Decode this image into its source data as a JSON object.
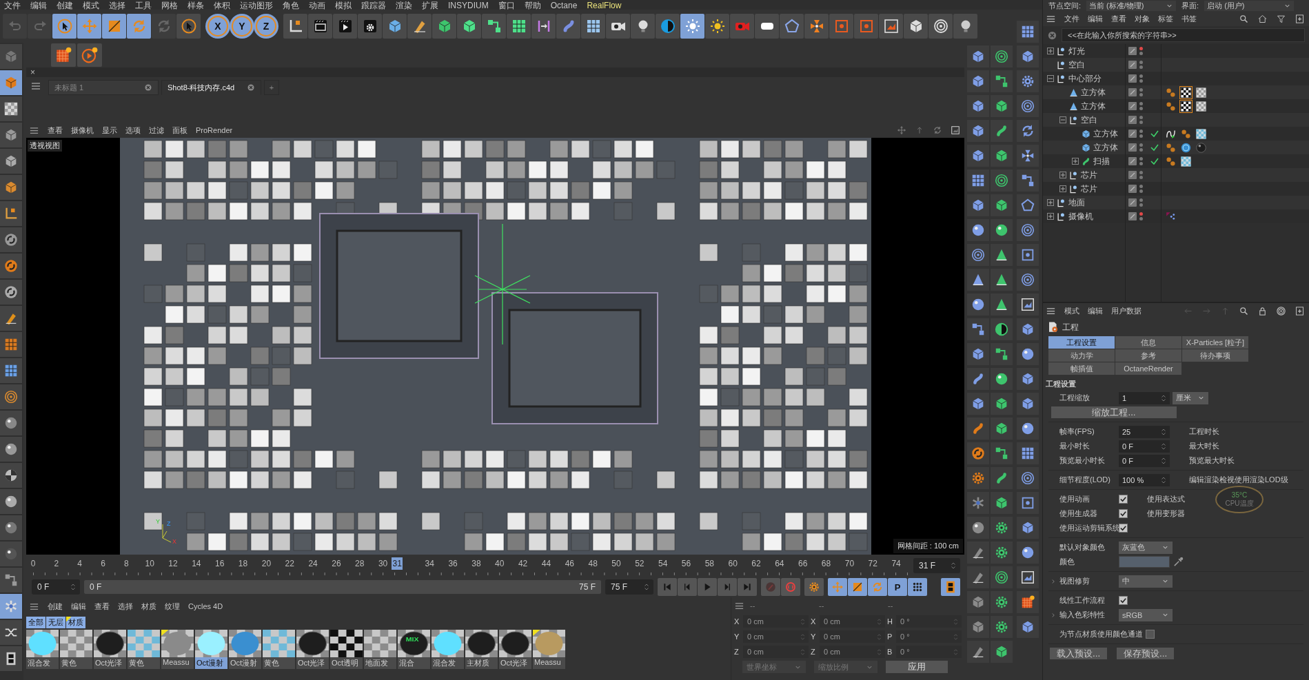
{
  "menu_bar": [
    {
      "label": "文件",
      "highlighted": false
    },
    {
      "label": "编辑",
      "highlighted": false
    },
    {
      "label": "创建",
      "highlighted": false
    },
    {
      "label": "模式",
      "highlighted": false
    },
    {
      "label": "选择",
      "highlighted": false
    },
    {
      "label": "工具",
      "highlighted": false
    },
    {
      "label": "网格",
      "highlighted": false
    },
    {
      "label": "样条",
      "highlighted": false
    },
    {
      "label": "体积",
      "highlighted": false
    },
    {
      "label": "运动图形",
      "highlighted": false
    },
    {
      "label": "角色",
      "highlighted": false
    },
    {
      "label": "动画",
      "highlighted": false
    },
    {
      "label": "模拟",
      "highlighted": false
    },
    {
      "label": "跟踪器",
      "highlighted": false
    },
    {
      "label": "渲染",
      "highlighted": false
    },
    {
      "label": "扩展",
      "highlighted": false
    },
    {
      "label": "INSYDIUM",
      "highlighted": false
    },
    {
      "label": "窗口",
      "highlighted": false
    },
    {
      "label": "帮助",
      "highlighted": false
    },
    {
      "label": "Octane",
      "highlighted": false
    },
    {
      "label": "RealFlow",
      "highlighted": true
    }
  ],
  "node_space": {
    "label": "节点空间:",
    "value": "当前 (标准/物理)"
  },
  "interface": {
    "label": "界面:",
    "value": "启动 (用户)"
  },
  "toolbar_left": [
    {
      "selected": false,
      "disabled": true
    },
    {
      "selected": false,
      "disabled": true
    },
    {
      "selected": true,
      "disabled": false
    },
    {
      "selected": true,
      "disabled": false
    },
    {
      "selected": true,
      "disabled": false
    },
    {
      "selected": true,
      "disabled": false
    },
    {
      "selected": false,
      "disabled": true
    },
    {
      "selected": false,
      "disabled": false
    }
  ],
  "axis_buttons": [
    {
      "label": "X",
      "selected": true
    },
    {
      "label": "Y",
      "selected": true
    },
    {
      "label": "Z",
      "selected": true
    }
  ],
  "toolbar_right": [
    {
      "selected": false
    },
    {
      "selected": false
    },
    {
      "selected": false
    },
    {
      "selected": false
    },
    {
      "selected": false
    },
    {
      "selected": false
    },
    {
      "selected": false
    },
    {
      "selected": false
    },
    {
      "selected": false
    },
    {
      "selected": false
    },
    {
      "selected": false
    },
    {
      "selected": false
    },
    {
      "selected": false
    },
    {
      "selected": false
    },
    {
      "selected": false
    },
    {
      "selected": false
    },
    {
      "selected": true
    },
    {
      "selected": false
    },
    {
      "selected": false
    },
    {
      "selected": false
    },
    {
      "selected": false
    },
    {
      "selected": false
    },
    {
      "selected": false
    },
    {
      "selected": false
    },
    {
      "selected": false
    },
    {
      "selected": false
    },
    {
      "selected": false
    },
    {
      "selected": false
    }
  ],
  "left_palette": [
    {
      "selected": false
    },
    {
      "selected": true
    },
    {
      "selected": false
    },
    {
      "selected": false
    },
    {
      "selected": false
    },
    {
      "selected": false
    },
    {
      "selected": false
    },
    {
      "selected": false
    },
    {
      "selected": false
    },
    {
      "selected": false
    },
    {
      "selected": false
    },
    {
      "selected": false
    },
    {
      "selected": false
    },
    {
      "selected": false
    },
    {
      "selected": false
    },
    {
      "selected": false
    },
    {
      "selected": false
    },
    {
      "selected": false
    },
    {
      "selected": false
    },
    {
      "selected": false
    },
    {
      "selected": false
    },
    {
      "selected": true
    },
    {
      "selected": false
    },
    {
      "selected": false
    }
  ],
  "close_glyph": "×",
  "document_tabs": [
    {
      "label": "未标题 1",
      "selected": false
    },
    {
      "label": "Shot8-科技内存.c4d",
      "selected": true
    }
  ],
  "add_tab": "+",
  "viewport": {
    "menu": [
      "查看",
      "摄像机",
      "显示",
      "选项",
      "过滤",
      "面板",
      "ProRender"
    ],
    "camera_label": "透视视图",
    "grid_label": "网格间距 : 100 cm",
    "axes": [
      "Y",
      "Z",
      "X"
    ]
  },
  "timeline": {
    "ticks": [
      "0",
      "2",
      "4",
      "6",
      "8",
      "10",
      "12",
      "14",
      "16",
      "18",
      "20",
      "22",
      "24",
      "26",
      "28",
      "30",
      "34",
      "36",
      "38",
      "40",
      "42",
      "44",
      "46",
      "48",
      "50",
      "52",
      "54",
      "56",
      "58",
      "60",
      "62",
      "64",
      "66",
      "68",
      "70",
      "72",
      "74"
    ],
    "current": "31",
    "level": 0.4133,
    "frame_field": "31 F"
  },
  "range": {
    "start": "0 F",
    "slider_start": "0 F",
    "slider_end": "75 F",
    "end": "75 F",
    "level": 1
  },
  "transport_tools": [
    {
      "selected": true
    },
    {
      "selected": true
    },
    {
      "selected": true
    },
    {
      "selected": true
    },
    {
      "selected": true
    }
  ],
  "param_label": "P",
  "film_selected": true,
  "material_menu": [
    "创建",
    "编辑",
    "查看",
    "选择",
    "材质",
    "纹理",
    "Cycles 4D"
  ],
  "material_filters": [
    {
      "label": "全部",
      "selected": true,
      "flagged": false
    },
    {
      "label": "无层",
      "selected": true,
      "flagged": false
    },
    {
      "label": "材质",
      "selected": true,
      "flagged": true
    }
  ],
  "materials": [
    {
      "name": "混合发",
      "kind": "glow",
      "selected": false,
      "flagged": false
    },
    {
      "name": "黄色",
      "kind": "checker",
      "selected": false,
      "flagged": false
    },
    {
      "name": "Oct光泽",
      "kind": "dark",
      "selected": false,
      "flagged": false
    },
    {
      "name": "黄色",
      "kind": "bluecheck",
      "selected": false,
      "flagged": false
    },
    {
      "name": "Meassu",
      "kind": "grey",
      "selected": false,
      "flagged": true
    },
    {
      "name": "Oct漫射",
      "kind": "cyan",
      "selected": true,
      "flagged": false
    },
    {
      "name": "Oct漫射",
      "kind": "glass",
      "selected": false,
      "flagged": false
    },
    {
      "name": "黄色",
      "kind": "bluecheck",
      "selected": false,
      "flagged": false
    },
    {
      "name": "Oct光泽",
      "kind": "dark",
      "selected": false,
      "flagged": false
    },
    {
      "name": "Oct透明",
      "kind": "bwchecker",
      "selected": false,
      "flagged": false
    },
    {
      "name": "地面发",
      "kind": "checker",
      "selected": false,
      "flagged": false
    },
    {
      "name": "混合",
      "kind": "dark",
      "selected": false,
      "flagged": false,
      "badge": "MIX"
    },
    {
      "name": "混合发",
      "kind": "glow",
      "selected": false,
      "flagged": false
    },
    {
      "name": "主材质",
      "kind": "dark",
      "selected": false,
      "flagged": false
    },
    {
      "name": "Oct光泽",
      "kind": "dark",
      "selected": false,
      "flagged": false
    },
    {
      "name": "Meassu",
      "kind": "gold",
      "selected": false,
      "flagged": true
    }
  ],
  "coordinates": {
    "headers": [
      "--",
      "--",
      "--"
    ],
    "rows": [
      [
        {
          "axis": "X",
          "value": "0 cm"
        },
        {
          "axis": "X",
          "value": "0 cm"
        },
        {
          "axis": "H",
          "value": "0 °"
        }
      ],
      [
        {
          "axis": "Y",
          "value": "0 cm"
        },
        {
          "axis": "Y",
          "value": "0 cm"
        },
        {
          "axis": "P",
          "value": "0 °"
        }
      ],
      [
        {
          "axis": "Z",
          "value": "0 cm"
        },
        {
          "axis": "Z",
          "value": "0 cm"
        },
        {
          "axis": "B",
          "value": "0 °"
        }
      ]
    ],
    "dropdowns": [
      "世界坐标",
      "缩放比例"
    ],
    "apply": "应用"
  },
  "object_manager": {
    "menu": [
      "文件",
      "编辑",
      "查看",
      "对象",
      "标签",
      "书签"
    ],
    "search": {
      "placeholder": "<<在此输入你所搜索的字符串>>"
    },
    "objects": [
      {
        "name": "灯光",
        "kind": "null",
        "expanded": false,
        "editor_hidden": true
      },
      {
        "name": "空白",
        "kind": "null",
        "editor_hidden": false
      },
      {
        "name": "中心部分",
        "kind": "null",
        "expanded": true,
        "editor_hidden": false,
        "children": [
          {
            "name": "立方体",
            "kind": "cone",
            "editor_hidden": false,
            "tags": [
              {
                "kind": "phong",
                "selected": false
              },
              {
                "kind": "bwchecker",
                "selected": true
              },
              {
                "kind": "checker",
                "selected": false
              }
            ]
          },
          {
            "name": "立方体",
            "kind": "cone",
            "editor_hidden": false,
            "tags": [
              {
                "kind": "phong",
                "selected": false
              },
              {
                "kind": "bwchecker",
                "selected": true
              },
              {
                "kind": "checker",
                "selected": false
              }
            ]
          },
          {
            "name": "空白",
            "kind": "null",
            "expanded": true,
            "editor_hidden": false,
            "children": [
              {
                "name": "立方体",
                "kind": "cube",
                "editor_hidden": false,
                "enabled": true,
                "tags": [
                  {
                    "kind": "spline",
                    "selected": false
                  },
                  {
                    "kind": "phong",
                    "selected": false
                  },
                  {
                    "kind": "bluecheck",
                    "selected": false
                  }
                ]
              },
              {
                "name": "立方体",
                "kind": "cube",
                "editor_hidden": false,
                "enabled": true,
                "tags": [
                  {
                    "kind": "phong",
                    "selected": false
                  },
                  {
                    "kind": "glass",
                    "selected": false
                  },
                  {
                    "kind": "dark",
                    "selected": false
                  }
                ]
              },
              {
                "name": "扫描",
                "kind": "sweep",
                "expanded": false,
                "editor_hidden": false,
                "enabled": true,
                "tags": [
                  {
                    "kind": "phong",
                    "selected": false
                  },
                  {
                    "kind": "bluecheck",
                    "selected": false
                  }
                ]
              }
            ]
          },
          {
            "name": "芯片",
            "kind": "null",
            "expanded": false,
            "editor_hidden": false
          },
          {
            "name": "芯片",
            "kind": "null",
            "expanded": false,
            "editor_hidden": false
          }
        ]
      },
      {
        "name": "地面",
        "kind": "null",
        "expanded": false,
        "editor_hidden": false
      },
      {
        "name": "摄像机",
        "kind": "null",
        "expanded": false,
        "editor_hidden": true,
        "tags": [
          {
            "kind": "target",
            "selected": false
          }
        ]
      }
    ]
  },
  "attributes": {
    "menu": [
      "模式",
      "编辑",
      "用户数据"
    ],
    "title": "工程",
    "tabs": [
      {
        "label": "工程设置",
        "selected": true
      },
      {
        "label": "信息",
        "selected": false
      },
      {
        "label": "X-Particles [粒子]",
        "selected": false
      },
      {
        "label": "动力学",
        "selected": false
      },
      {
        "label": "参考",
        "selected": false
      },
      {
        "label": "待办事项",
        "selected": false
      },
      {
        "label": "帧插值",
        "selected": false
      },
      {
        "label": "OctaneRender",
        "selected": false
      }
    ],
    "section": "工程设置",
    "scale": {
      "label": "工程缩放",
      "value": "1",
      "unit": "厘米"
    },
    "scale_button": "缩放工程...",
    "time_rows": [
      {
        "label": "帧率(FPS)",
        "value": "25",
        "right_label": "工程时长"
      },
      {
        "label": "最小时长",
        "value": "0 F",
        "right_label": "最大时长"
      },
      {
        "label": "预览最小时长",
        "value": "0 F",
        "right_label": "预览最大时长"
      }
    ],
    "lod": {
      "label": "细节程度(LOD)",
      "value": "100 %",
      "right_label": "编辑渲染检视使用渲染LOD级"
    },
    "check_rows": [
      {
        "label": "使用动画",
        "checked": true,
        "right_label": "使用表达式"
      },
      {
        "label": "使用生成器",
        "checked": true,
        "right_label": "使用变形器"
      },
      {
        "label": "使用运动剪辑系统",
        "checked": true
      }
    ],
    "default_color": {
      "label": "默认对象颜色",
      "value": "灰蓝色"
    },
    "color": {
      "label": "颜色",
      "color": "#56606c"
    },
    "view_clip": {
      "label": "视图修剪",
      "value": "中"
    },
    "linear": {
      "label": "线性工作流程",
      "checked": true
    },
    "input_color": {
      "label": "输入色彩特性",
      "value": "sRGB"
    },
    "node_color": {
      "label": "为节点材质使用颜色通道",
      "checked": false
    },
    "buttons": [
      "载入预设...",
      "保存预设..."
    ]
  },
  "cpu_overlay": {
    "temperature": "35°C",
    "label": "CPU温度"
  }
}
